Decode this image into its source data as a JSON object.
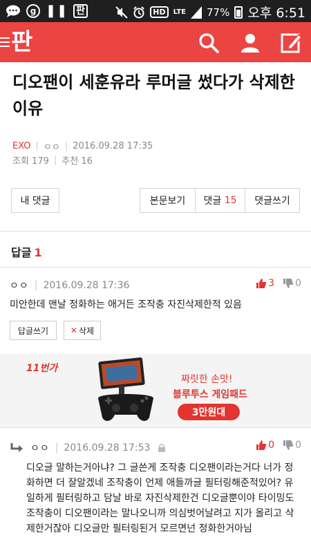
{
  "status_bar": {
    "battery": "77%",
    "network": "LTE",
    "hd": "HD",
    "time": "오후 6:51",
    "left_icons": [
      "chat-bubble-icon",
      "g-circle-icon",
      "pause-icon",
      "pan-app-icon"
    ]
  },
  "header": {
    "logo_text": "판",
    "brand_color": "#ec4343"
  },
  "post": {
    "title": "디오팬이 세훈유라 루머글 썼다가 삭제한 이유",
    "category": "EXO",
    "author": "ㅇㅇ",
    "datetime": "2016.09.28 17:35",
    "views_label": "조회 179",
    "recommend_label": "추천 16"
  },
  "buttons": {
    "my_comments": "내 댓글",
    "view_body": "본문보기",
    "comments_label": "댓글",
    "comments_count": "15",
    "write_comment": "댓글쓰기"
  },
  "replies": {
    "label": "답글",
    "count": "1"
  },
  "comments": [
    {
      "nick": "ㅇㅇ",
      "datetime": "2016.09.28 17:36",
      "up": "3",
      "down": "0",
      "text": "미안한데 맨날 정화하는 애거든 조작충 자진삭제한적 있음",
      "reply_btn": "답글쓰기",
      "delete_btn": "삭제"
    },
    {
      "nick": "ㅇㅇ",
      "datetime": "2016.09.28 17:53",
      "up": "0",
      "down": "0",
      "text": "디오글 말하는거아냐? 그 글쓴게 조작충 디오팬이라는거다 너가 정화하면 더 잘알겠네 조작충이 언제 애들까글 필터링해준적있어? 유일하게 필터링하고 담날 바로 자진삭제한건 디오글뿐이야 타이밍도 조작충이 디오팬이라는 말나오니까 의심벗어날려고 지가 올리고 삭제한거잖아 디오글만 필터링된거 모르면넌 정화한거아님"
    }
  ],
  "ad": {
    "brand": "11번가",
    "line1": "짜릿한 손맛!",
    "line2": "블루투스 게임패드",
    "price": "3만원대"
  }
}
